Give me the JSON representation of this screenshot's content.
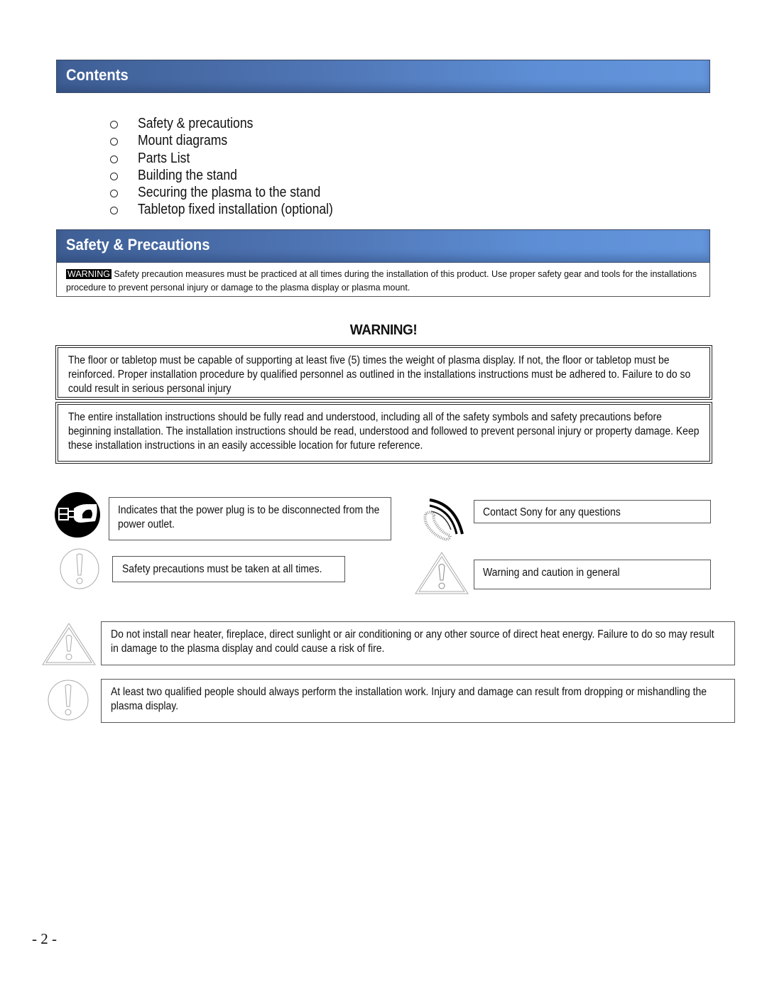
{
  "contents": {
    "title": "Contents",
    "items": [
      {
        "label": "Safety & precautions"
      },
      {
        "label": "Mount diagrams"
      },
      {
        "label": "Parts List"
      },
      {
        "label": "Building the stand"
      },
      {
        "label": "Securing the plasma to the stand"
      },
      {
        "label": "Tabletop fixed installation (optional)"
      }
    ]
  },
  "safety": {
    "title": "Safety & Precautions",
    "intro": {
      "tag": "WARNING",
      "text": " Safety precaution measures must be practiced at all times during the installation of this product. Use proper safety gear and tools for the installations procedure to prevent personal injury or damage to the plasma display or plasma mount."
    },
    "warning_heading": "WARNING!",
    "warning_boxes": [
      {
        "text": "The floor or tabletop must be capable of supporting at least five (5) times the weight of plasma display. If not, the floor or tabletop must be reinforced. Proper installation procedure by qualified personnel as outlined in the installations instructions must be adhered to. Failure to do so could result in serious personal injury"
      },
      {
        "text": "The entire installation instructions should be fully read and understood, including all of the safety symbols and safety precautions before beginning installation.  The installation instructions should be read, understood and followed to prevent personal injury or property damage. Keep these installation instructions in an easily accessible location for future reference."
      }
    ],
    "symbols": [
      {
        "icon": "unplug-icon",
        "text": "Indicates that the power plug is to be disconnected from the power outlet."
      },
      {
        "icon": "exclamation-circle-icon",
        "text": "Safety precautions must be taken at all times."
      },
      {
        "icon": "phone-icon",
        "text": "Contact Sony for any questions"
      },
      {
        "icon": "warning-triangle-icon",
        "text": "Warning and caution in general"
      }
    ],
    "notices": [
      {
        "icon": "warning-triangle-icon",
        "text": "Do not install near heater, fireplace, direct sunlight or air conditioning or any other source of direct heat energy.  Failure to do so may result in damage to the plasma display and could cause a risk of fire."
      },
      {
        "icon": "exclamation-circle-icon",
        "text": "At least two qualified people should always perform the installation work. Injury and damage can result from dropping or mishandling the plasma display."
      }
    ]
  },
  "footer": {
    "page_number": "- 2 -"
  }
}
